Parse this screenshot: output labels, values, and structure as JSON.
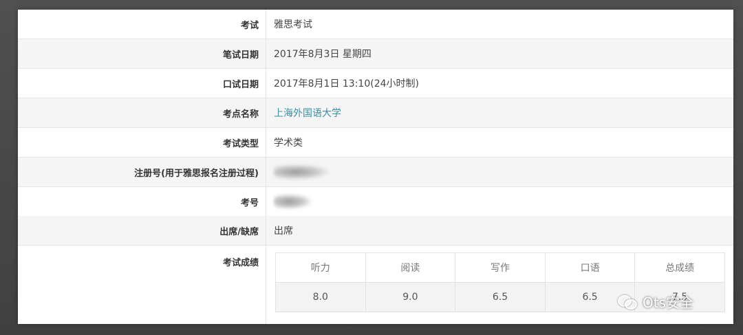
{
  "rows": [
    {
      "label": "考试",
      "value": "雅思考试"
    },
    {
      "label": "笔试日期",
      "value": "2017年8月3日 星期四"
    },
    {
      "label": "口试日期",
      "value": "2017年8月1日 13:10(24小时制)"
    },
    {
      "label": "考点名称",
      "value": "上海外国语大学"
    },
    {
      "label": "考试类型",
      "value": "学术类"
    },
    {
      "label": "注册号(用于雅思报名注册过程)",
      "value": ""
    },
    {
      "label": "考号",
      "value": ""
    },
    {
      "label": "出席/缺席",
      "value": "出席"
    },
    {
      "label": "考试成绩",
      "value": ""
    }
  ],
  "scores": {
    "headers": [
      "听力",
      "阅读",
      "写作",
      "口语",
      "总成绩"
    ],
    "values": [
      "8.0",
      "9.0",
      "6.5",
      "6.5",
      "7.5"
    ]
  },
  "watermark": {
    "text": "Ots安全"
  },
  "colors": {
    "link": "#3a8fa2",
    "alt_row": "#f5f5f5",
    "border": "#e4e4e4"
  }
}
